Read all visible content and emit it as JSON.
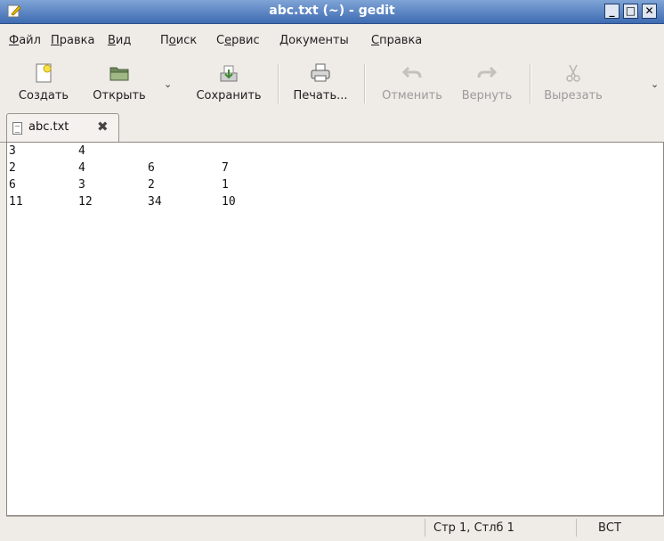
{
  "window": {
    "title": "abc.txt (~) - gedit"
  },
  "menu": [
    {
      "pre": "",
      "u": "Ф",
      "post": "айл"
    },
    {
      "pre": "",
      "u": "П",
      "post": "равка"
    },
    {
      "pre": "",
      "u": "В",
      "post": "ид"
    },
    {
      "pre": "П",
      "u": "о",
      "post": "иск"
    },
    {
      "pre": "С",
      "u": "е",
      "post": "рвис"
    },
    {
      "pre": "",
      "u": "Д",
      "post": "окументы"
    },
    {
      "pre": "",
      "u": "С",
      "post": "правка"
    }
  ],
  "toolbar": {
    "new": "Создать",
    "open": "Открыть",
    "save": "Сохранить",
    "print": "Печать...",
    "undo": "Отменить",
    "redo": "Вернуть",
    "cut": "Вырезать",
    "arrow": "⌄"
  },
  "tab": {
    "label": "abc.txt",
    "close": "✖"
  },
  "document": {
    "lines": [
      [
        "3",
        "4"
      ],
      [
        "2",
        "4",
        "6",
        "7"
      ],
      [
        "6",
        "3",
        "2",
        "1"
      ],
      [
        "11",
        "12",
        "34",
        "10"
      ]
    ]
  },
  "status": {
    "position": "Стр 1, Стлб 1",
    "mode": "ВСТ"
  }
}
